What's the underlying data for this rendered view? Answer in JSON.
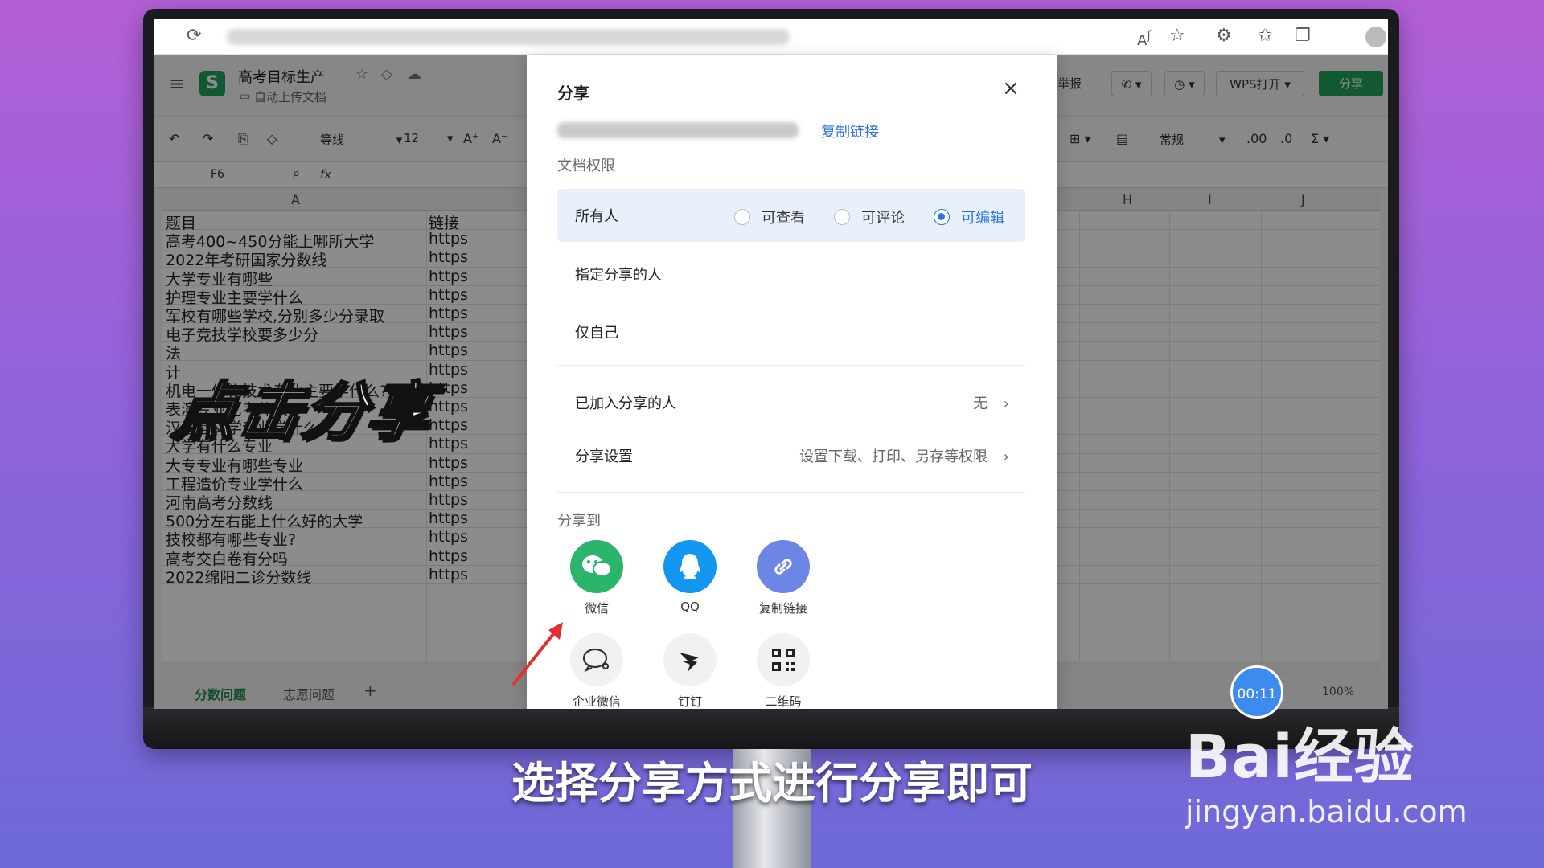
{
  "browser": {
    "refresh_icon": "refresh-icon"
  },
  "app": {
    "doc_title": "高考目标生产",
    "doc_sub": "自动上传文档",
    "font_name": "等线",
    "font_size": "12",
    "cell_ref": "F6",
    "fx": "fx",
    "col_a": "A",
    "col_h": "H",
    "col_i": "I",
    "col_j": "J",
    "number_format": "常规",
    "report": "举报",
    "wps_open": "WPS打开",
    "share_button": "分享",
    "zoom": "100%",
    "rows": [
      {
        "a": "题目",
        "b": "链接"
      },
      {
        "a": "高考400~450分能上哪所大学",
        "b": "https"
      },
      {
        "a": "2022年考研国家分数线",
        "b": "https"
      },
      {
        "a": "大学专业有哪些",
        "b": "https"
      },
      {
        "a": "护理专业主要学什么",
        "b": "https"
      },
      {
        "a": "军校有哪些学校,分别多少分录取",
        "b": "https"
      },
      {
        "a": "电子竞技学校要多少分",
        "b": "https"
      },
      {
        "a": "法",
        "b": "https"
      },
      {
        "a": "计",
        "b": "https"
      },
      {
        "a": "机电一体化技术专业主要学什么?",
        "b": "https"
      },
      {
        "a": "表演专业艺考什么",
        "b": "https"
      },
      {
        "a": "汉语言文学专业学什么",
        "b": "https"
      },
      {
        "a": "大学有什么专业",
        "b": "https"
      },
      {
        "a": "大专专业有哪些专业",
        "b": "https"
      },
      {
        "a": "工程造价专业学什么",
        "b": "https"
      },
      {
        "a": "河南高考分数线",
        "b": "https"
      },
      {
        "a": "500分左右能上什么好的大学",
        "b": "https"
      },
      {
        "a": "技校都有哪些专业?",
        "b": "https"
      },
      {
        "a": "高考交白卷有分吗",
        "b": "https"
      },
      {
        "a": "2022绵阳二诊分数线",
        "b": "https"
      }
    ],
    "sheet_tabs": [
      "分数问题",
      "志愿问题"
    ],
    "add_sheet": "+"
  },
  "dialog": {
    "title": "分享",
    "close": "×",
    "copy_link": "复制链接",
    "perm_label": "文档权限",
    "everyone": "所有人",
    "radios": [
      "可查看",
      "可评论",
      "可编辑"
    ],
    "selected_radio": "可编辑",
    "specified": "指定分享的人",
    "only_me": "仅自己",
    "joined_label": "已加入分享的人",
    "joined_value": "无",
    "settings_label": "分享设置",
    "settings_value": "设置下载、打印、另存等权限",
    "share_to": "分享到",
    "targets": [
      {
        "label": "微信",
        "icon": "wechat-icon",
        "color": "#2bb56a"
      },
      {
        "label": "QQ",
        "icon": "qq-icon",
        "color": "#1296f0"
      },
      {
        "label": "复制链接",
        "icon": "link-icon",
        "color": "#6d86e6"
      },
      {
        "label": "企业微信",
        "icon": "wecom-icon",
        "color": "#f1f1f1"
      },
      {
        "label": "钉钉",
        "icon": "dingtalk-icon",
        "color": "#f1f1f1"
      },
      {
        "label": "二维码",
        "icon": "qrcode-icon",
        "color": "#f1f1f1"
      }
    ]
  },
  "overlay": {
    "headline": "点击分享",
    "subtitle": "选择分享方式进行分享即可",
    "timer": "00:11",
    "watermark_main": "Bai经验",
    "watermark_url": "jingyan.baidu.com"
  }
}
